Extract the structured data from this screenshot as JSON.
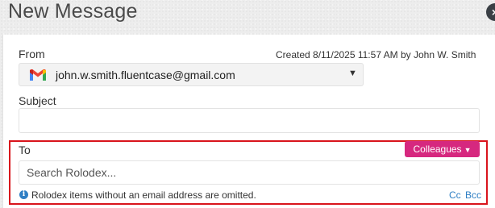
{
  "header": {
    "title": "New Message",
    "close_label": "×"
  },
  "from": {
    "label": "From",
    "created_text": "Created 8/11/2025 11:57 AM by John W. Smith",
    "selected_account": "john.w.smith.fluentcase@gmail.com",
    "account_icon": "gmail-icon",
    "caret": "▼"
  },
  "subject": {
    "label": "Subject",
    "value": ""
  },
  "to": {
    "label": "To",
    "group_button_label": "Colleagues",
    "group_button_caret": "▼",
    "search_placeholder": "Search Rolodex...",
    "note_icon": "i",
    "note": "Rolodex items without an email address are omitted.",
    "cc_label": "Cc",
    "bcc_label": "Bcc"
  },
  "colors": {
    "accent_pink": "#d6287f",
    "highlight_red": "#d9141c",
    "link_blue": "#2f7fc4"
  }
}
